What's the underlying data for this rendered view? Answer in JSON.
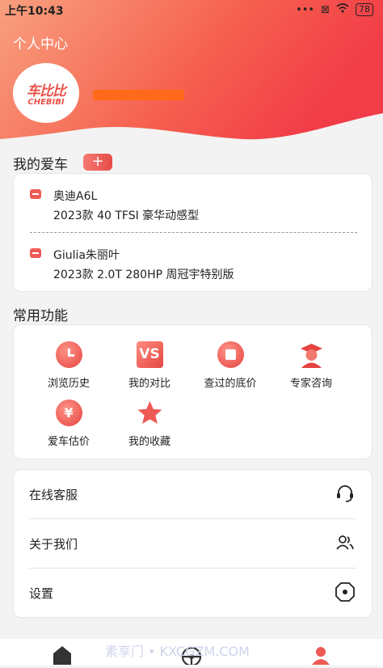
{
  "status_bar": {
    "time": "上午10:43",
    "battery": "78"
  },
  "header": {
    "title": "个人中心",
    "logo_cn": "车比比",
    "logo_en": "CHEBIBI"
  },
  "my_cars": {
    "title": "我的爱车",
    "add_label": "+",
    "cars": [
      {
        "name": "奥迪A6L",
        "detail": "2023款 40 TFSI 豪华动感型"
      },
      {
        "name": "Giulia朱丽叶",
        "detail": "2023款 2.0T 280HP 周冠宇特别版"
      }
    ]
  },
  "functions": {
    "title": "常用功能",
    "items": [
      {
        "label": "浏览历史",
        "icon": "clock-icon"
      },
      {
        "label": "我的对比",
        "icon": "vs-icon",
        "icon_text": "VS"
      },
      {
        "label": "查过的底价",
        "icon": "calendar-price-icon"
      },
      {
        "label": "专家咨询",
        "icon": "expert-icon"
      },
      {
        "label": "爱车估价",
        "icon": "yen-icon",
        "icon_text": "¥"
      },
      {
        "label": "我的收藏",
        "icon": "star-icon"
      }
    ]
  },
  "menu": [
    {
      "label": "在线客服",
      "icon": "headset-icon"
    },
    {
      "label": "关于我们",
      "icon": "users-icon"
    },
    {
      "label": "设置",
      "icon": "settings-icon"
    }
  ],
  "bottom_nav": {
    "watermark": "素享门 • KXCGZM.COM"
  },
  "colors": {
    "accent": "#e9534a",
    "header_gradient_start": "#f7a283",
    "header_gradient_end": "#f5404a"
  }
}
